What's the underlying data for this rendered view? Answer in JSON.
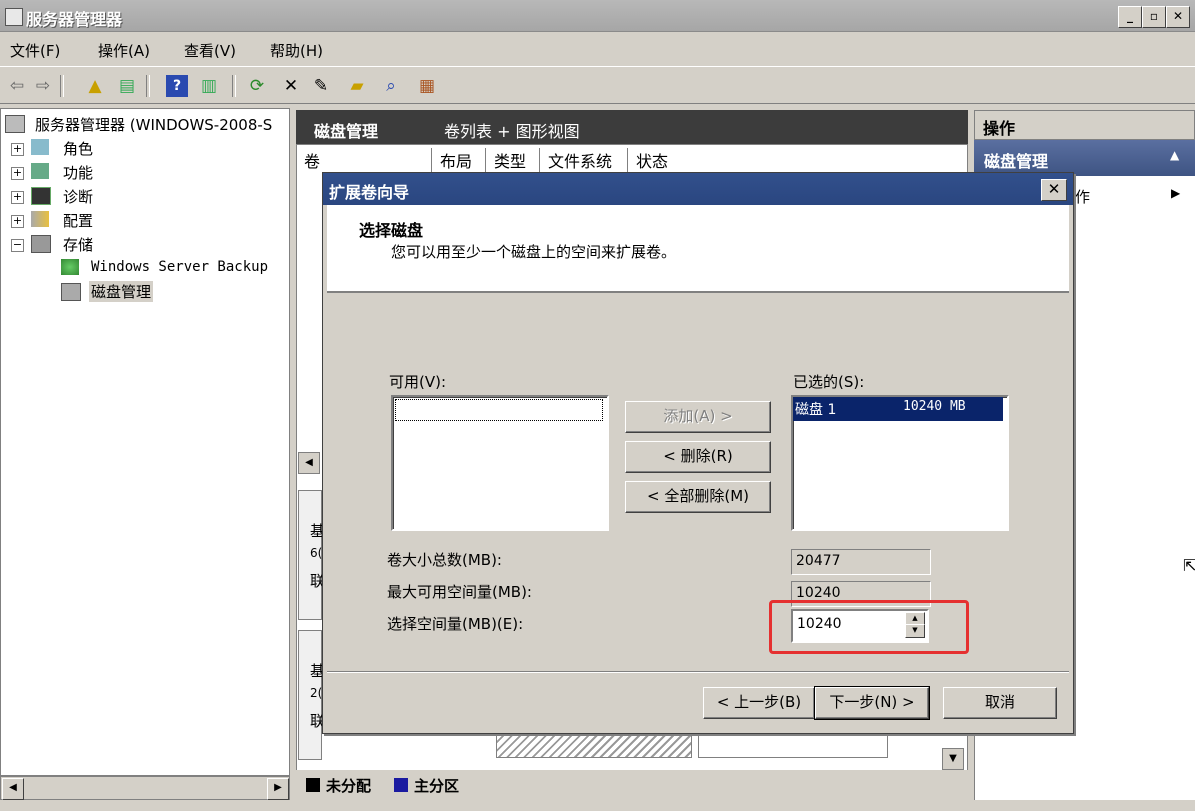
{
  "window": {
    "title": "服务器管理器"
  },
  "menu": [
    "文件(F)",
    "操作(A)",
    "查看(V)",
    "帮助(H)"
  ],
  "tree": {
    "root": "服务器管理器 (WINDOWS-2008-S",
    "items": [
      "角色",
      "功能",
      "诊断",
      "配置",
      "存储"
    ],
    "storage_children": [
      "Windows Server Backup",
      "磁盘管理"
    ]
  },
  "middle": {
    "title": "磁盘管理",
    "view": "卷列表 + 图形视图",
    "columns": [
      "卷",
      "布局",
      "类型",
      "文件系统",
      "状态"
    ],
    "fragments": [
      "基",
      "6(",
      "联",
      "基",
      "2(",
      "联"
    ]
  },
  "actions": {
    "header": "操作",
    "section": "磁盘管理",
    "more": "作"
  },
  "legend": {
    "unallocated": "未分配",
    "primary": "主分区"
  },
  "dialog": {
    "title": "扩展卷向导",
    "heading": "选择磁盘",
    "subheading": "您可以用至少一个磁盘上的空间来扩展卷。",
    "available_label": "可用(V):",
    "selected_label": "已选的(S):",
    "selected_items": [
      {
        "name": "磁盘 1",
        "size": "10240 MB"
      }
    ],
    "add_button": "添加(A) >",
    "remove_button": "< 删除(R)",
    "remove_all_button": "< 全部删除(M)",
    "total_label": "卷大小总数(MB):",
    "total_value": "20477",
    "max_label": "最大可用空间量(MB):",
    "max_value": "10240",
    "select_label": "选择空间量(MB)(E):",
    "select_value": "10240",
    "back_button": "< 上一步(B)",
    "next_button": "下一步(N) >",
    "cancel_button": "取消"
  }
}
